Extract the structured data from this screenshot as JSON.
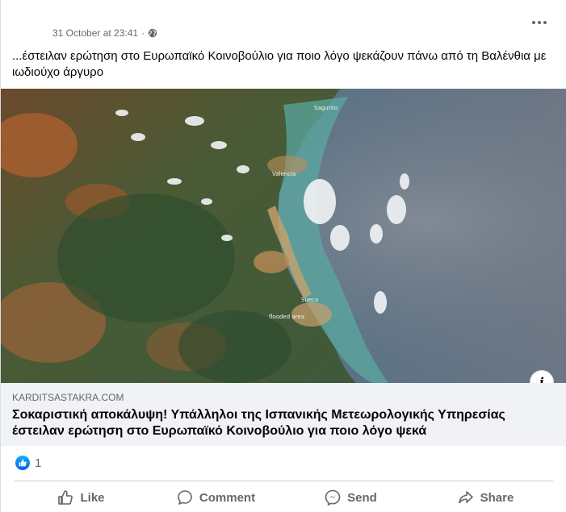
{
  "post": {
    "timestamp": "31 October at 23:41",
    "separator": "·",
    "text": "...έστειλαν ερώτηση στο Ευρωπαϊκό Κοινοβούλιο για ποιο λόγο ψεκάζουν πάνω από τη Βαλένθια με ιωδιούχο άργυρο"
  },
  "image": {
    "labels": [
      "Sagunto",
      "Valencia",
      "Sueca",
      "flooded area"
    ]
  },
  "link": {
    "domain": "KARDITSASTAKRA.COM",
    "title": "Σοκαριστική αποκάλυψη! Υπάλληλοι της Ισπανικής Μετεωρολογικής Υπηρεσίας έστειλαν ερώτηση στο Ευρωπαϊκό Κοινοβούλιο για ποιο λόγο ψεκά"
  },
  "reactions": {
    "count": "1"
  },
  "actions": {
    "like": "Like",
    "comment": "Comment",
    "send": "Send",
    "share": "Share"
  }
}
